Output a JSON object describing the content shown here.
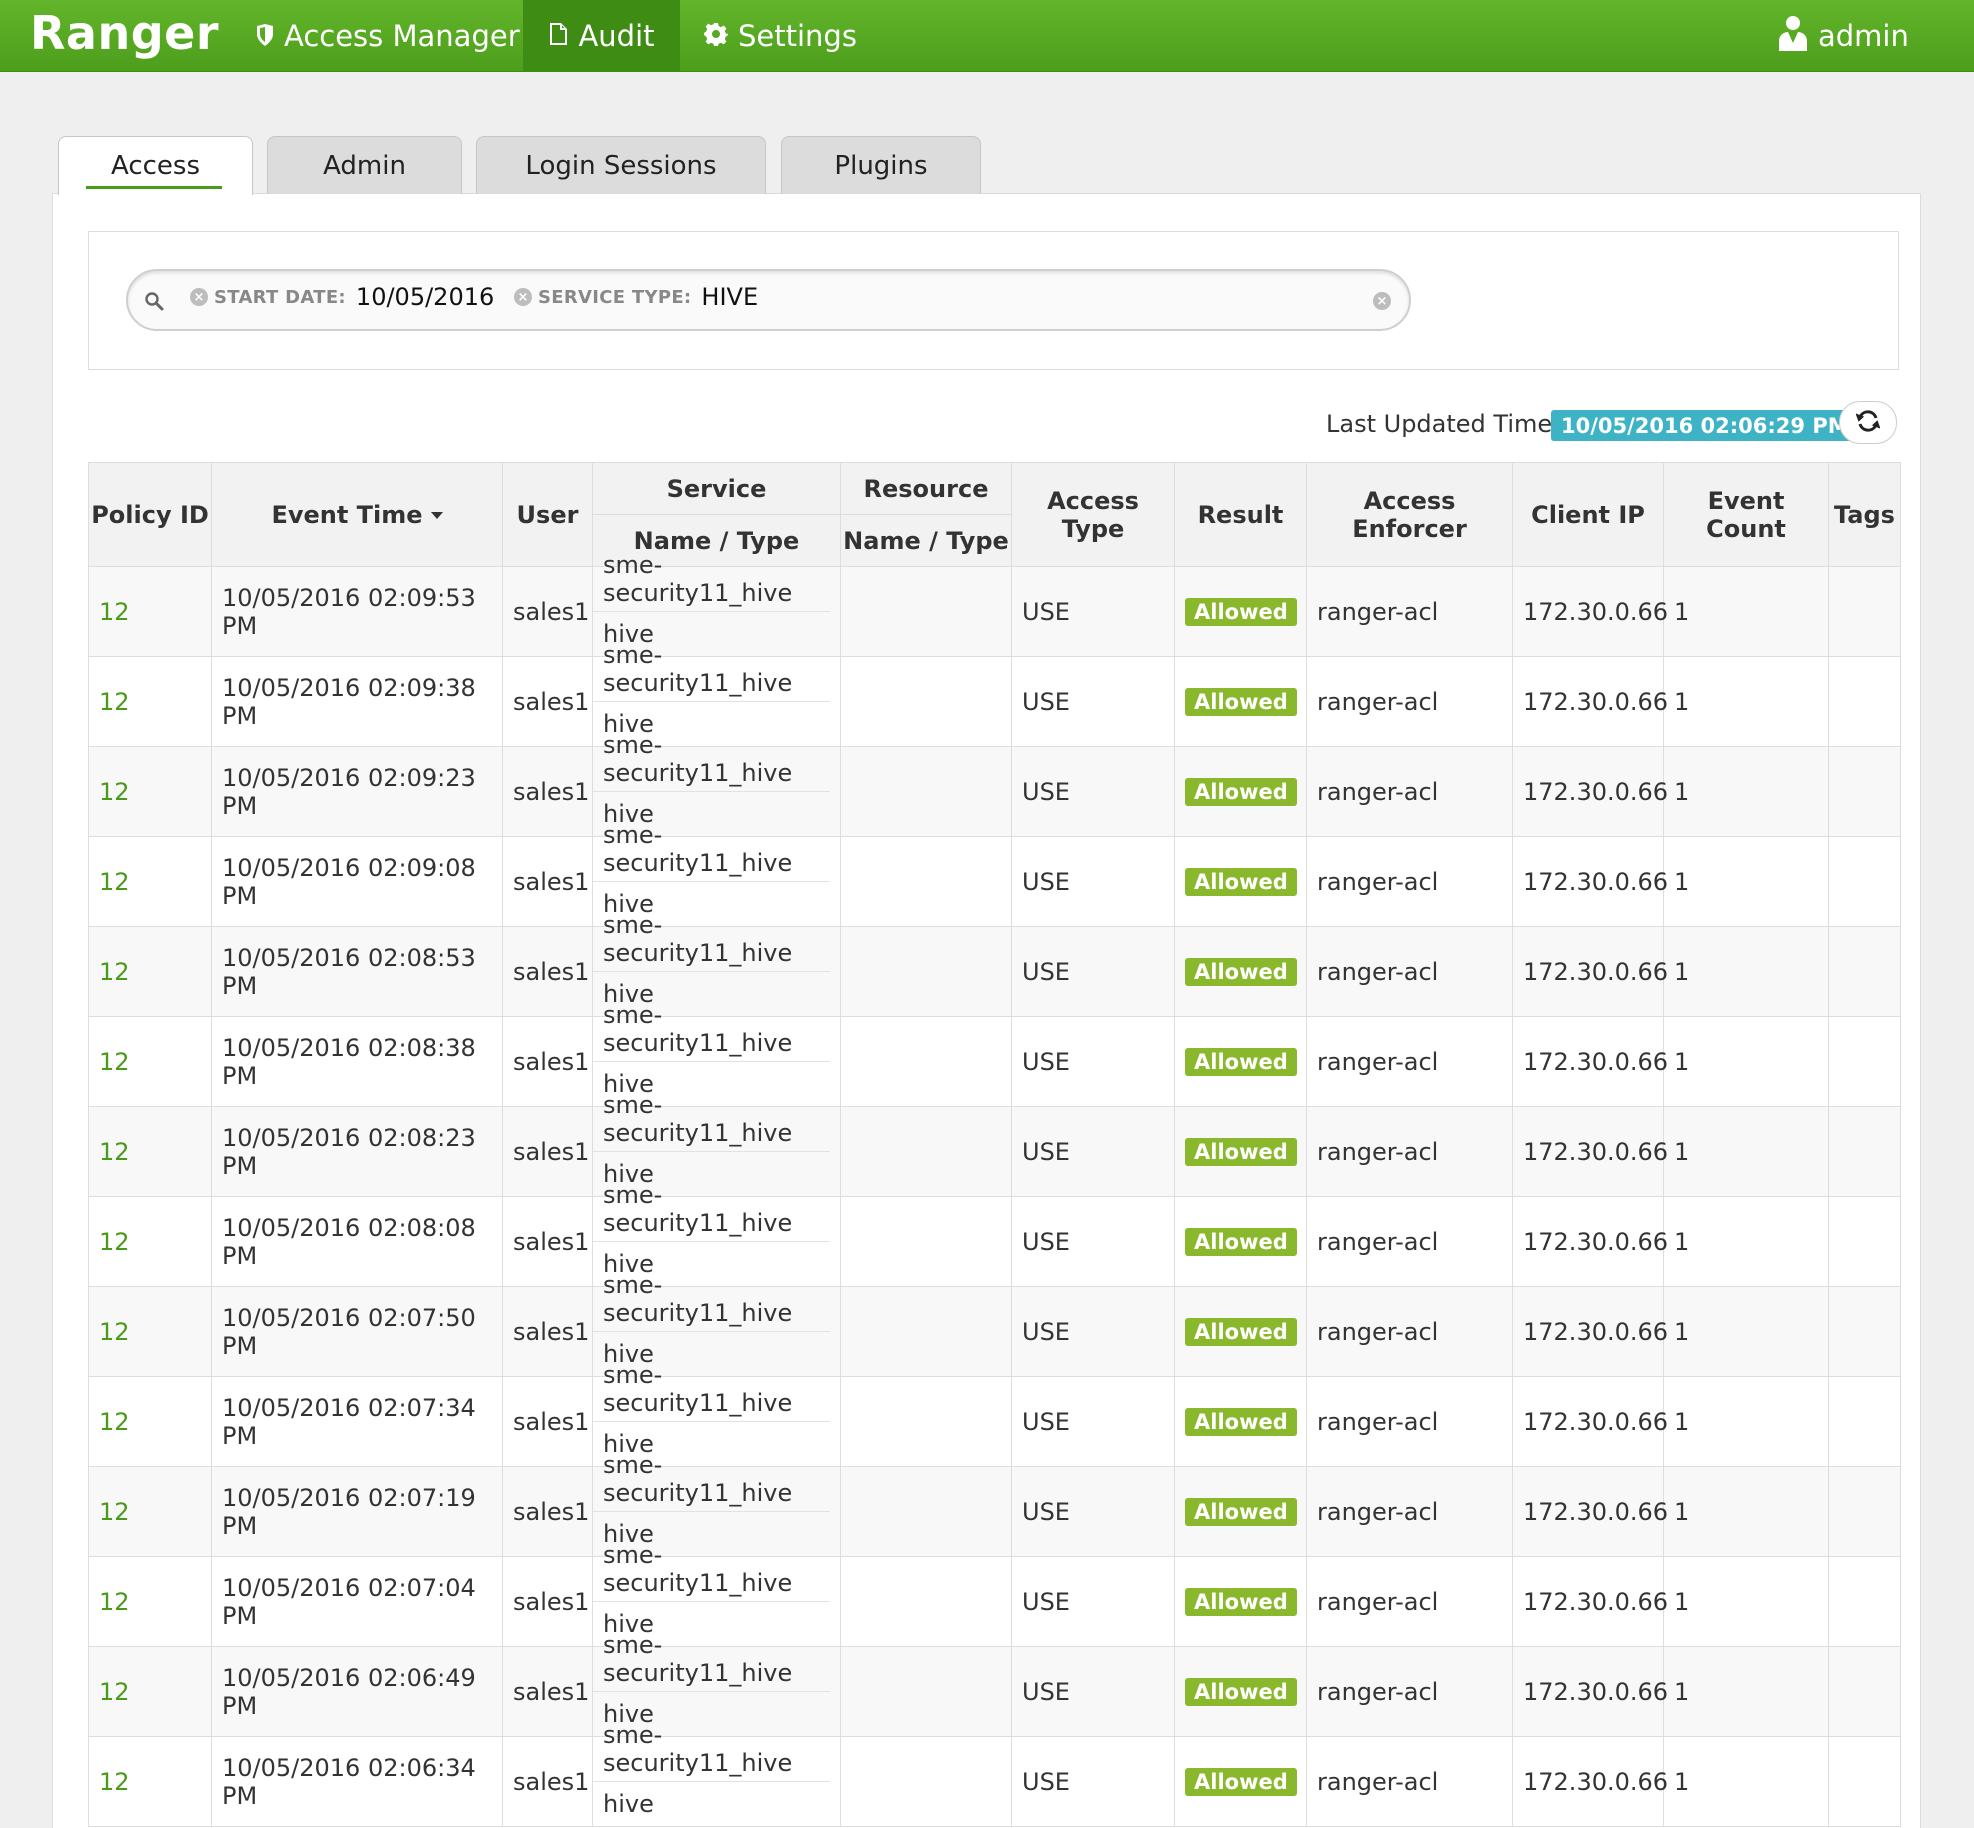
{
  "navbar": {
    "brand": "Ranger",
    "items": [
      {
        "label": "Access Manager",
        "icon": "shield-icon"
      },
      {
        "label": "Audit",
        "icon": "document-icon"
      },
      {
        "label": "Settings",
        "icon": "gear-icon"
      }
    ],
    "user": "admin",
    "user_icon": "user-icon",
    "colors": {
      "bar": "#56a823",
      "active": "#3e8c13"
    }
  },
  "tabs": [
    "Access",
    "Admin",
    "Login Sessions",
    "Plugins"
  ],
  "search": {
    "facets": [
      {
        "key": "START DATE:",
        "value": "10/05/2016"
      },
      {
        "key": "SERVICE TYPE:",
        "value": "HIVE"
      }
    ]
  },
  "last_updated": {
    "label": "Last Updated Time :",
    "value": "10/05/2016 02:06:29 PM",
    "color": "#3eb3c6"
  },
  "table": {
    "headers": {
      "policy_id": "Policy ID",
      "event_time": "Event Time",
      "user": "User",
      "service_group": "Service",
      "service_sub": "Name / Type",
      "resource_group": "Resource",
      "resource_sub": "Name / Type",
      "access_type": "Access Type",
      "result": "Result",
      "access_enforcer": "Access Enforcer",
      "client_ip": "Client IP",
      "event_count": "Event Count",
      "tags": "Tags"
    },
    "rows": [
      {
        "policy_id": "12",
        "event_time": "10/05/2016 02:09:53 PM",
        "user": "sales1",
        "service_name": "sme-security11_hive",
        "service_type": "hive",
        "access_type": "USE",
        "result": "Allowed",
        "enforcer": "ranger-acl",
        "client_ip": "172.30.0.66",
        "count": "1"
      },
      {
        "policy_id": "12",
        "event_time": "10/05/2016 02:09:38 PM",
        "user": "sales1",
        "service_name": "sme-security11_hive",
        "service_type": "hive",
        "access_type": "USE",
        "result": "Allowed",
        "enforcer": "ranger-acl",
        "client_ip": "172.30.0.66",
        "count": "1"
      },
      {
        "policy_id": "12",
        "event_time": "10/05/2016 02:09:23 PM",
        "user": "sales1",
        "service_name": "sme-security11_hive",
        "service_type": "hive",
        "access_type": "USE",
        "result": "Allowed",
        "enforcer": "ranger-acl",
        "client_ip": "172.30.0.66",
        "count": "1"
      },
      {
        "policy_id": "12",
        "event_time": "10/05/2016 02:09:08 PM",
        "user": "sales1",
        "service_name": "sme-security11_hive",
        "service_type": "hive",
        "access_type": "USE",
        "result": "Allowed",
        "enforcer": "ranger-acl",
        "client_ip": "172.30.0.66",
        "count": "1"
      },
      {
        "policy_id": "12",
        "event_time": "10/05/2016 02:08:53 PM",
        "user": "sales1",
        "service_name": "sme-security11_hive",
        "service_type": "hive",
        "access_type": "USE",
        "result": "Allowed",
        "enforcer": "ranger-acl",
        "client_ip": "172.30.0.66",
        "count": "1"
      },
      {
        "policy_id": "12",
        "event_time": "10/05/2016 02:08:38 PM",
        "user": "sales1",
        "service_name": "sme-security11_hive",
        "service_type": "hive",
        "access_type": "USE",
        "result": "Allowed",
        "enforcer": "ranger-acl",
        "client_ip": "172.30.0.66",
        "count": "1"
      },
      {
        "policy_id": "12",
        "event_time": "10/05/2016 02:08:23 PM",
        "user": "sales1",
        "service_name": "sme-security11_hive",
        "service_type": "hive",
        "access_type": "USE",
        "result": "Allowed",
        "enforcer": "ranger-acl",
        "client_ip": "172.30.0.66",
        "count": "1"
      },
      {
        "policy_id": "12",
        "event_time": "10/05/2016 02:08:08 PM",
        "user": "sales1",
        "service_name": "sme-security11_hive",
        "service_type": "hive",
        "access_type": "USE",
        "result": "Allowed",
        "enforcer": "ranger-acl",
        "client_ip": "172.30.0.66",
        "count": "1"
      },
      {
        "policy_id": "12",
        "event_time": "10/05/2016 02:07:50 PM",
        "user": "sales1",
        "service_name": "sme-security11_hive",
        "service_type": "hive",
        "access_type": "USE",
        "result": "Allowed",
        "enforcer": "ranger-acl",
        "client_ip": "172.30.0.66",
        "count": "1"
      },
      {
        "policy_id": "12",
        "event_time": "10/05/2016 02:07:34 PM",
        "user": "sales1",
        "service_name": "sme-security11_hive",
        "service_type": "hive",
        "access_type": "USE",
        "result": "Allowed",
        "enforcer": "ranger-acl",
        "client_ip": "172.30.0.66",
        "count": "1"
      },
      {
        "policy_id": "12",
        "event_time": "10/05/2016 02:07:19 PM",
        "user": "sales1",
        "service_name": "sme-security11_hive",
        "service_type": "hive",
        "access_type": "USE",
        "result": "Allowed",
        "enforcer": "ranger-acl",
        "client_ip": "172.30.0.66",
        "count": "1"
      },
      {
        "policy_id": "12",
        "event_time": "10/05/2016 02:07:04 PM",
        "user": "sales1",
        "service_name": "sme-security11_hive",
        "service_type": "hive",
        "access_type": "USE",
        "result": "Allowed",
        "enforcer": "ranger-acl",
        "client_ip": "172.30.0.66",
        "count": "1"
      },
      {
        "policy_id": "12",
        "event_time": "10/05/2016 02:06:49 PM",
        "user": "sales1",
        "service_name": "sme-security11_hive",
        "service_type": "hive",
        "access_type": "USE",
        "result": "Allowed",
        "enforcer": "ranger-acl",
        "client_ip": "172.30.0.66",
        "count": "1"
      },
      {
        "policy_id": "12",
        "event_time": "10/05/2016 02:06:34 PM",
        "user": "sales1",
        "service_name": "sme-security11_hive",
        "service_type": "hive",
        "access_type": "USE",
        "result": "Allowed",
        "enforcer": "ranger-acl",
        "client_ip": "172.30.0.66",
        "count": "1"
      }
    ],
    "allowed_color": "#8ab82c",
    "policy_link_color": "#4a9a1a"
  }
}
